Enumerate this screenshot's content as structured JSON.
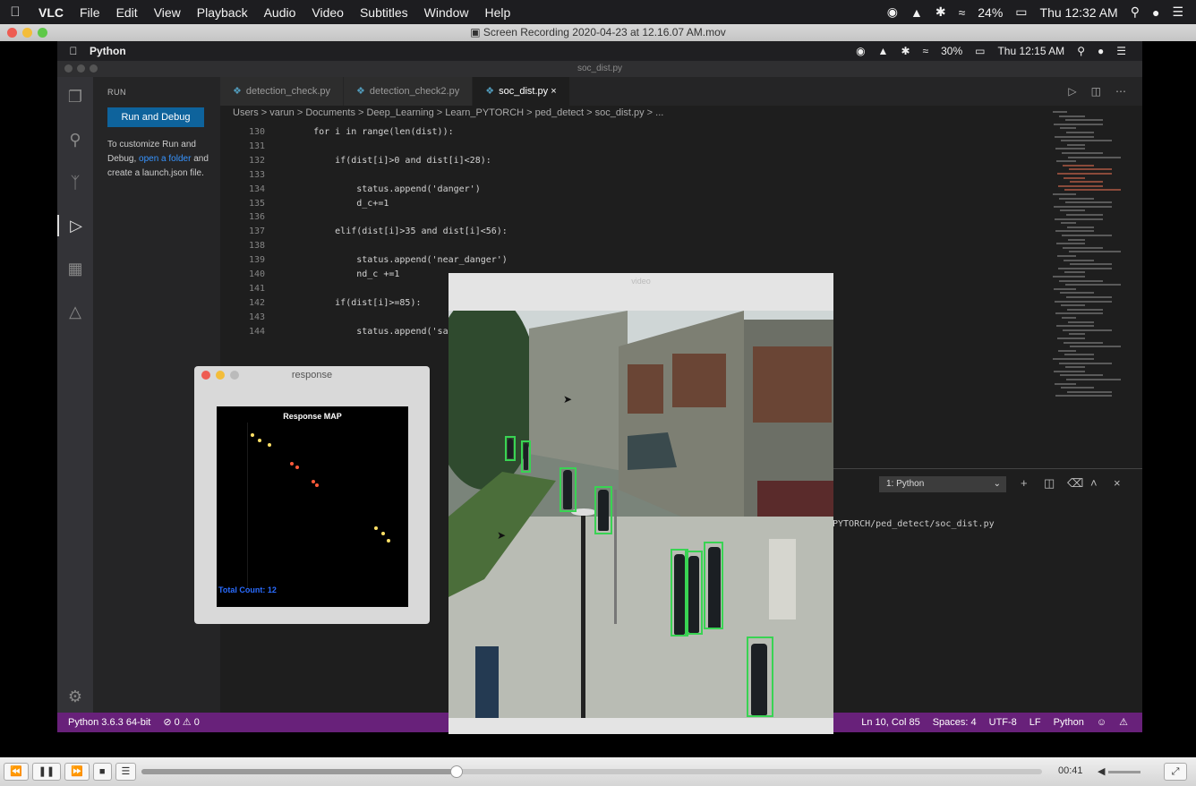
{
  "vlc_menubar": {
    "apple": "",
    "items": [
      "VLC",
      "File",
      "Edit",
      "View",
      "Playback",
      "Audio",
      "Video",
      "Subtitles",
      "Window",
      "Help"
    ],
    "battery": "24%",
    "clock": "Thu 12:32 AM"
  },
  "vlc_window": {
    "title": "Screen Recording 2020-04-23 at 12.16.07 AM.mov"
  },
  "inner_menubar": {
    "app": "Python",
    "battery": "30%",
    "clock": "Thu 12:15 AM"
  },
  "vscode": {
    "window_title": "soc_dist.py",
    "sidebar": {
      "header": "RUN",
      "run_button": "Run and Debug",
      "text_before_link": "To customize Run and Debug,",
      "link": "open a folder",
      "text_after_link": "and create a launch.json file."
    },
    "tabs": [
      {
        "label": "detection_check.py",
        "active": false
      },
      {
        "label": "detection_check2.py",
        "active": false
      },
      {
        "label": "soc_dist.py",
        "active": true
      }
    ],
    "breadcrumb": "Users > varun > Documents > Deep_Learning > Learn_PYTORCH > ped_detect > soc_dist.py > ...",
    "code_lines": [
      {
        "num": "130",
        "text": "    for i in range(len(dist)):"
      },
      {
        "num": "131",
        "text": ""
      },
      {
        "num": "132",
        "text": "        if(dist[i]>0 and dist[i]<28):"
      },
      {
        "num": "133",
        "text": ""
      },
      {
        "num": "134",
        "text": "            status.append('danger')"
      },
      {
        "num": "135",
        "text": "            d_c+=1"
      },
      {
        "num": "136",
        "text": ""
      },
      {
        "num": "137",
        "text": "        elif(dist[i]>35 and dist[i]<56):"
      },
      {
        "num": "138",
        "text": ""
      },
      {
        "num": "139",
        "text": "            status.append('near_danger')"
      },
      {
        "num": "140",
        "text": "            nd_c +=1"
      },
      {
        "num": "141",
        "text": ""
      },
      {
        "num": "142",
        "text": "        if(dist[i]>=85):"
      },
      {
        "num": "143",
        "text": ""
      },
      {
        "num": "144",
        "text": "            status.append('safe')"
      }
    ],
    "panel": {
      "terminal_select": "1: Python",
      "output_path": "PYTORCH/ped_detect/soc_dist.py"
    },
    "statusbar": {
      "interpreter": "Python 3.6.3 64-bit",
      "problems": "⊘ 0 ⚠ 0",
      "position": "Ln 10, Col 85",
      "spaces": "Spaces: 4",
      "encoding": "UTF-8",
      "eol": "LF",
      "language": "Python"
    }
  },
  "response_window": {
    "title": "response",
    "map_title": "Response MAP",
    "count": "Total Count: 12"
  },
  "video_window": {
    "title": "video"
  },
  "vlc_controls": {
    "elapsed": "00:41",
    "progress": 0.35
  }
}
